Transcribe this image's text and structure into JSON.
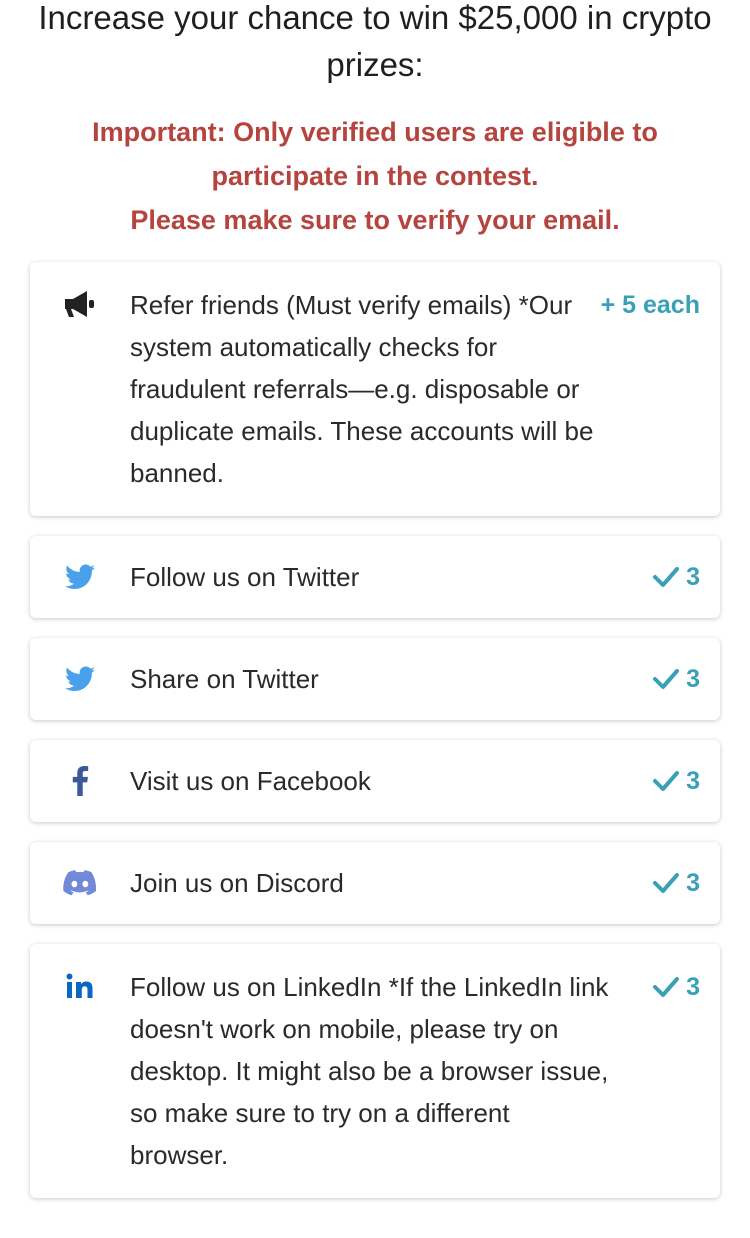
{
  "heading": "Increase your chance to win $25,000 in crypto prizes:",
  "notice": {
    "line1": "Important: Only verified users are eligible to participate in the contest.",
    "line2": "Please make sure to verify your email."
  },
  "colors": {
    "notice": "#b5433e",
    "points": "#3aa0b8",
    "twitter": "#4aa1eb",
    "facebook": "#3b5998",
    "discord": "#7289da",
    "linkedin": "#0a66c2"
  },
  "tasks": [
    {
      "icon": "megaphone-icon",
      "text": "Refer friends (Must verify emails) *Our system automatically checks for fraudulent referrals—e.g. disposable or duplicate emails. These accounts will be banned.",
      "points": "+ 5 each"
    },
    {
      "icon": "twitter-icon",
      "text": "Follow us on Twitter",
      "points": "3"
    },
    {
      "icon": "twitter-icon",
      "text": "Share on Twitter",
      "points": "3"
    },
    {
      "icon": "facebook-icon",
      "text": "Visit us on Facebook",
      "points": "3"
    },
    {
      "icon": "discord-icon",
      "text": "Join us on Discord",
      "points": "3"
    },
    {
      "icon": "linkedin-icon",
      "text": "Follow us on LinkedIn *If the LinkedIn link doesn't work on mobile, please try on desktop. It might also be a browser issue, so make sure to try on a different browser.",
      "points": "3"
    }
  ]
}
